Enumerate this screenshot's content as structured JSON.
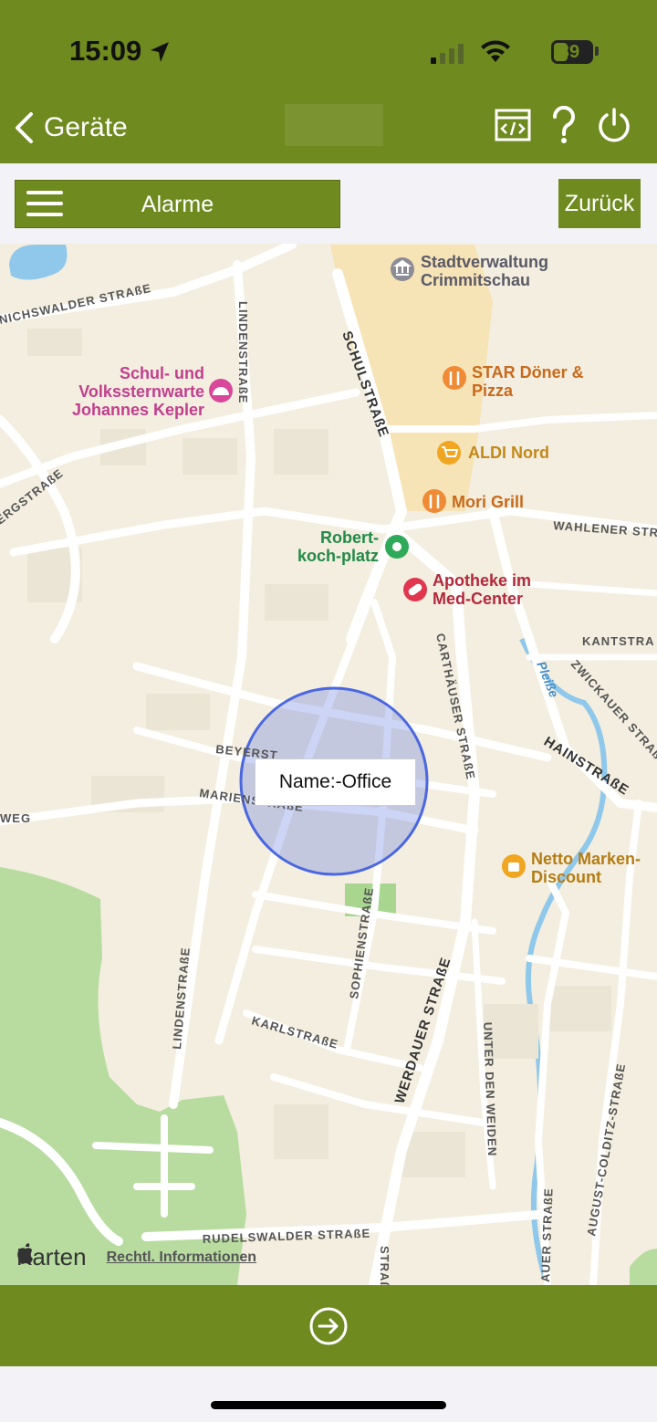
{
  "status": {
    "time": "15:09",
    "battery": "39"
  },
  "nav": {
    "back_label": "Geräte"
  },
  "toolbar": {
    "alarm_label": "Alarme",
    "back_button": "Zurück"
  },
  "map": {
    "geofence_label": "Name:-Office",
    "streets": {
      "lindenstrasse_top": "LINDENSTRAßE",
      "lindenstrasse_bottom": "LINDENSTRAßE",
      "schulstrasse": "SCHULSTRAßE",
      "nichswalder": "NICHSWALDER STRAßE",
      "ergstrasse": "ERGSTRAßE",
      "wahlener": "WAHLENER STR",
      "kantstrasse": "KANTSTRA",
      "zwickauer": "ZWICKAUER STRAßE",
      "hainstrasse": "HAINSTRAßE",
      "carthaeuser": "CARTHÄUSER STRAßE",
      "beyerstr": "BEYERST",
      "marienstrasse": "MARIENSTRAßE",
      "weg": "WEG",
      "sophienstrasse": "SOPHIENSTRAßE",
      "werdauer": "WERDAUER STRAßE",
      "karlstrasse": "KARLSTRAßE",
      "unter_den_weiden": "UNTER DEN WEIDEN",
      "august_colditz": "AUGUST-COLDITZ-STRAßE",
      "auer": "AUER STRAßE",
      "rudelswalder": "RUDELSWALDER STRAßE",
      "strasse_bottom": "STRAßE",
      "pleisse": "Pleiße"
    },
    "pois": {
      "stadtverwaltung": "Stadtverwaltung\nCrimmitschau",
      "sternwarte": "Schul- und\nVolkssternwarte\nJohannes Kepler",
      "star_doener": "STAR Döner &\nPizza",
      "aldi": "ALDI Nord",
      "mori": "Mori Grill",
      "robert_koch": "Robert-\nkoch-platz",
      "apotheke": "Apotheke im\nMed-Center",
      "netto": "Netto Marken-\nDiscount"
    },
    "attribution": {
      "brand": "Karten",
      "legal": "Rechtl. Informationen"
    }
  },
  "colors": {
    "brand_green": "#6f8a1e",
    "map_bg": "#f3eedf",
    "geofence": "#4a67e0"
  }
}
